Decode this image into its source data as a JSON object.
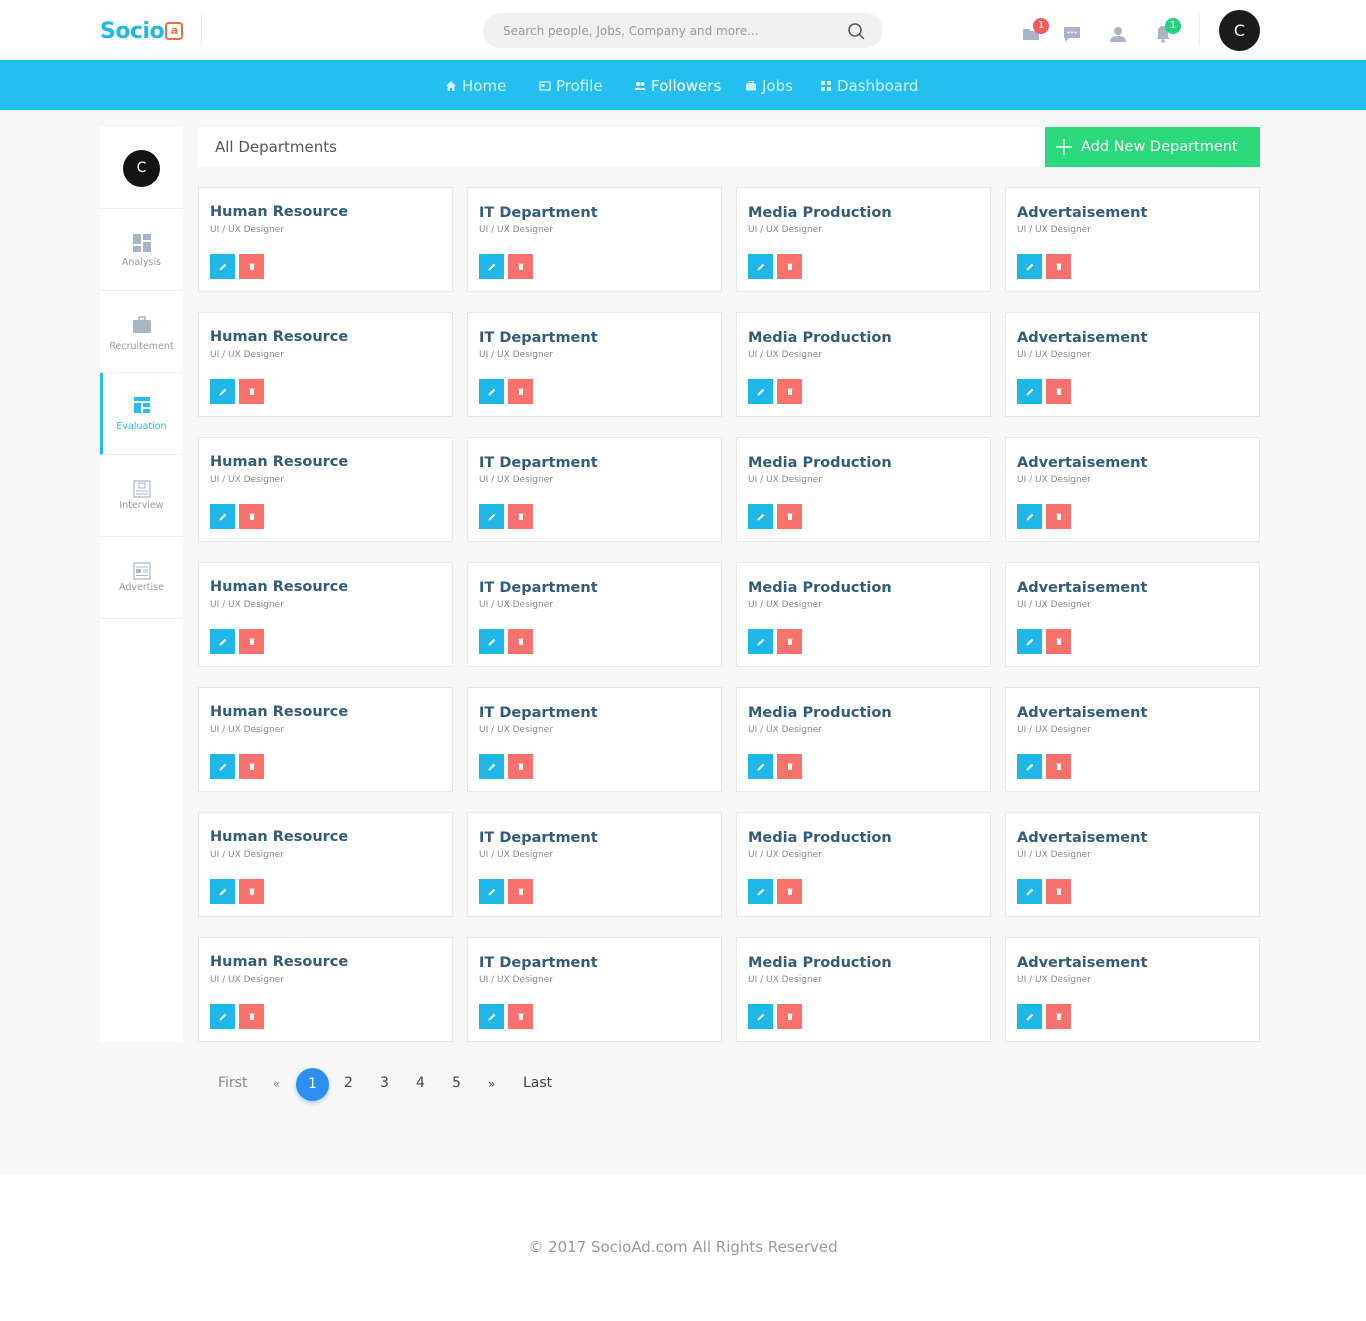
{
  "header": {
    "logo_text": "Socio",
    "logo_mark": "a",
    "search_placeholder": "Search people, Jobs, Company and more...",
    "icons": [
      {
        "name": "mail-icon",
        "badge": "1",
        "badge_color": "#f25c5c"
      },
      {
        "name": "message-icon",
        "badge": ""
      },
      {
        "name": "user-icon",
        "badge": ""
      },
      {
        "name": "bell-icon",
        "badge": "1",
        "badge_color": "#27d17f"
      }
    ],
    "avatar_initial": "C"
  },
  "nav": {
    "items": [
      {
        "label": "Home",
        "icon": "home-icon",
        "active": false
      },
      {
        "label": "Profile",
        "icon": "profile-icon",
        "active": false
      },
      {
        "label": "Followers",
        "icon": "followers-icon",
        "active": true
      },
      {
        "label": "Jobs",
        "icon": "jobs-icon",
        "active": false
      },
      {
        "label": "Dashboard",
        "icon": "dashboard-icon",
        "active": false
      }
    ]
  },
  "sidebar": {
    "avatar_initial": "C",
    "items": [
      {
        "label": "Analysis",
        "icon": "analysis-icon",
        "active": false
      },
      {
        "label": "Recruitement",
        "icon": "briefcase-icon",
        "active": false
      },
      {
        "label": "Evaluation",
        "icon": "evaluation-icon",
        "active": true
      },
      {
        "label": "Interview",
        "icon": "interview-icon",
        "active": false
      },
      {
        "label": "Advertise",
        "icon": "advertise-icon",
        "active": false
      }
    ]
  },
  "main": {
    "title": "All Departments",
    "add_button_label": "Add New Department",
    "departments": [
      [
        "Human Resource",
        "IT Department",
        "Media Production",
        "Advertaisement"
      ],
      [
        "Human Resource",
        "IT Department",
        "Media Production",
        "Advertaisement"
      ],
      [
        "Human Resource",
        "IT Department",
        "Media Production",
        "Advertaisement"
      ],
      [
        "Human Resource",
        "IT Department",
        "Media Production",
        "Advertaisement"
      ],
      [
        "Human Resource",
        "IT Department",
        "Media Production",
        "Advertaisement"
      ],
      [
        "Human Resource",
        "IT Department",
        "Media Production",
        "Advertaisement"
      ],
      [
        "Human Resource",
        "IT Department",
        "Media Production",
        "Advertaisement"
      ]
    ],
    "card_subtitle": "UI / UX Designer"
  },
  "pagination": {
    "first": "First",
    "prev": "«",
    "pages": [
      "1",
      "2",
      "3",
      "4",
      "5"
    ],
    "current": "1",
    "next": "»",
    "last": "Last"
  },
  "footer": {
    "text": "© 2017 SocioAd.com All Rights Reserved"
  },
  "colors": {
    "brand_blue": "#25bfef",
    "add_green": "#2bd87b",
    "edit_blue": "#1fb6e8",
    "delete_red": "#f8716c",
    "page_active": "#2d8ff0"
  }
}
